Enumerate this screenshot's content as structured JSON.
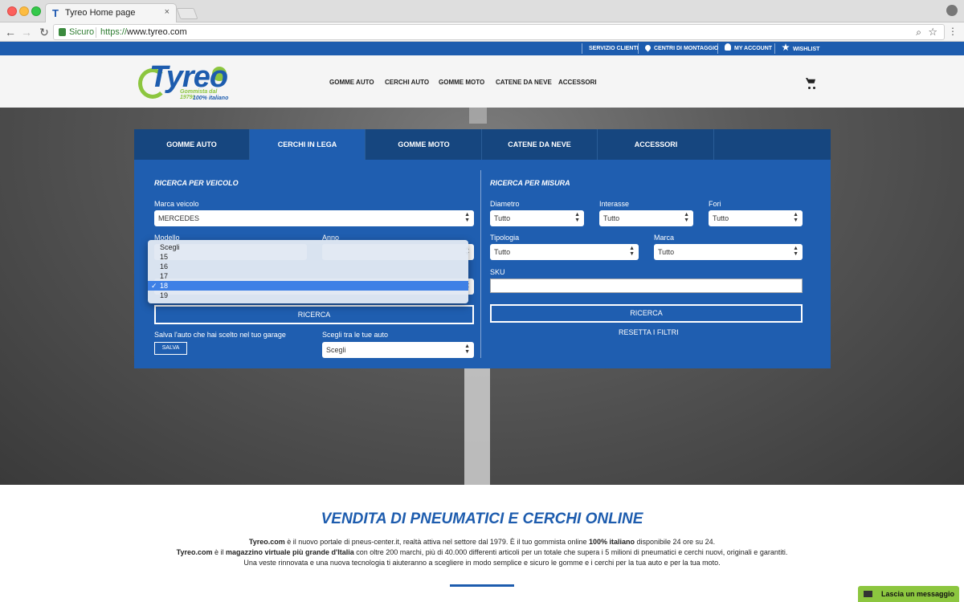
{
  "browser": {
    "tab_title": "Tyreo Home page",
    "tab_close": "×",
    "secure_label": "Sicuro",
    "url_proto": "https://",
    "url_host": "www.tyreo.com"
  },
  "topbar": {
    "links": [
      "SERVIZIO CLIENTI",
      "CENTRI DI MONTAGGIO",
      "MY ACCOUNT",
      "WISHLIST"
    ]
  },
  "logo": {
    "word": "Tyreo",
    "tagline1": "Gommista dal 1979!",
    "tagline2": "100% italiano"
  },
  "nav": {
    "items": [
      "GOMME AUTO",
      "CERCHI AUTO",
      "GOMME MOTO",
      "CATENE DA NEVE",
      "ACCESSORI"
    ]
  },
  "panel": {
    "tabs": [
      "GOMME AUTO",
      "CERCHI IN LEGA",
      "GOMME MOTO",
      "CATENE DA NEVE",
      "ACCESSORI"
    ],
    "active_tab": "CERCHI IN LEGA",
    "vehicle": {
      "title": "RICERCA PER VEICOLO",
      "brand_label": "Marca veicolo",
      "brand_value": "MERCEDES",
      "model_label": "Modello",
      "year_label": "Anno",
      "search_button": "RICERCA",
      "save_label": "Salva l'auto che hai scelto nel tuo garage",
      "save_button": "SALVA",
      "garage_label": "Scegli tra le tue auto",
      "garage_value": "Scegli"
    },
    "size": {
      "title": "RICERCA PER MISURA",
      "diameter_label": "Diametro",
      "diameter_value": "Tutto",
      "wheelbase_label": "Interasse",
      "wheelbase_value": "Tutto",
      "holes_label": "Fori",
      "holes_value": "Tutto",
      "type_label": "Tipologia",
      "type_value": "Tutto",
      "brand_label": "Marca",
      "brand_value": "Tutto",
      "sku_label": "SKU",
      "sku_value": "",
      "search_button": "RICERCA",
      "reset_link": "RESETTA I FILTRI"
    },
    "dropdown": {
      "options": [
        "Scegli",
        "15",
        "16",
        "17",
        "18",
        "19"
      ],
      "selected": "18",
      "check": "✓"
    }
  },
  "bottom": {
    "title": "VENDITA DI PNEUMATICI E CERCHI ONLINE",
    "line1": {
      "b1": "Tyreo.com",
      "t1": " è il nuovo portale di pneus-center.it, realtà attiva nel settore dal 1979. È il tuo gommista online ",
      "b2": "100% italiano",
      "t2": " disponibile 24 ore su 24."
    },
    "line2": {
      "b1": "Tyreo.com",
      "t1": " è il ",
      "b2": "magazzino virtuale più grande d'Italia",
      "t2": " con oltre 200 marchi, più di 40.000 differenti articoli per un totale che supera i 5 milioni di pneumatici e cerchi nuovi, originali e garantiti."
    },
    "line3": "Una veste rinnovata e una nuova tecnologia ti aiuteranno a scegliere in modo semplice e sicuro le gomme e i cerchi per la tua auto e per la tua moto."
  },
  "chat": {
    "label": "Lascia un messaggio"
  }
}
